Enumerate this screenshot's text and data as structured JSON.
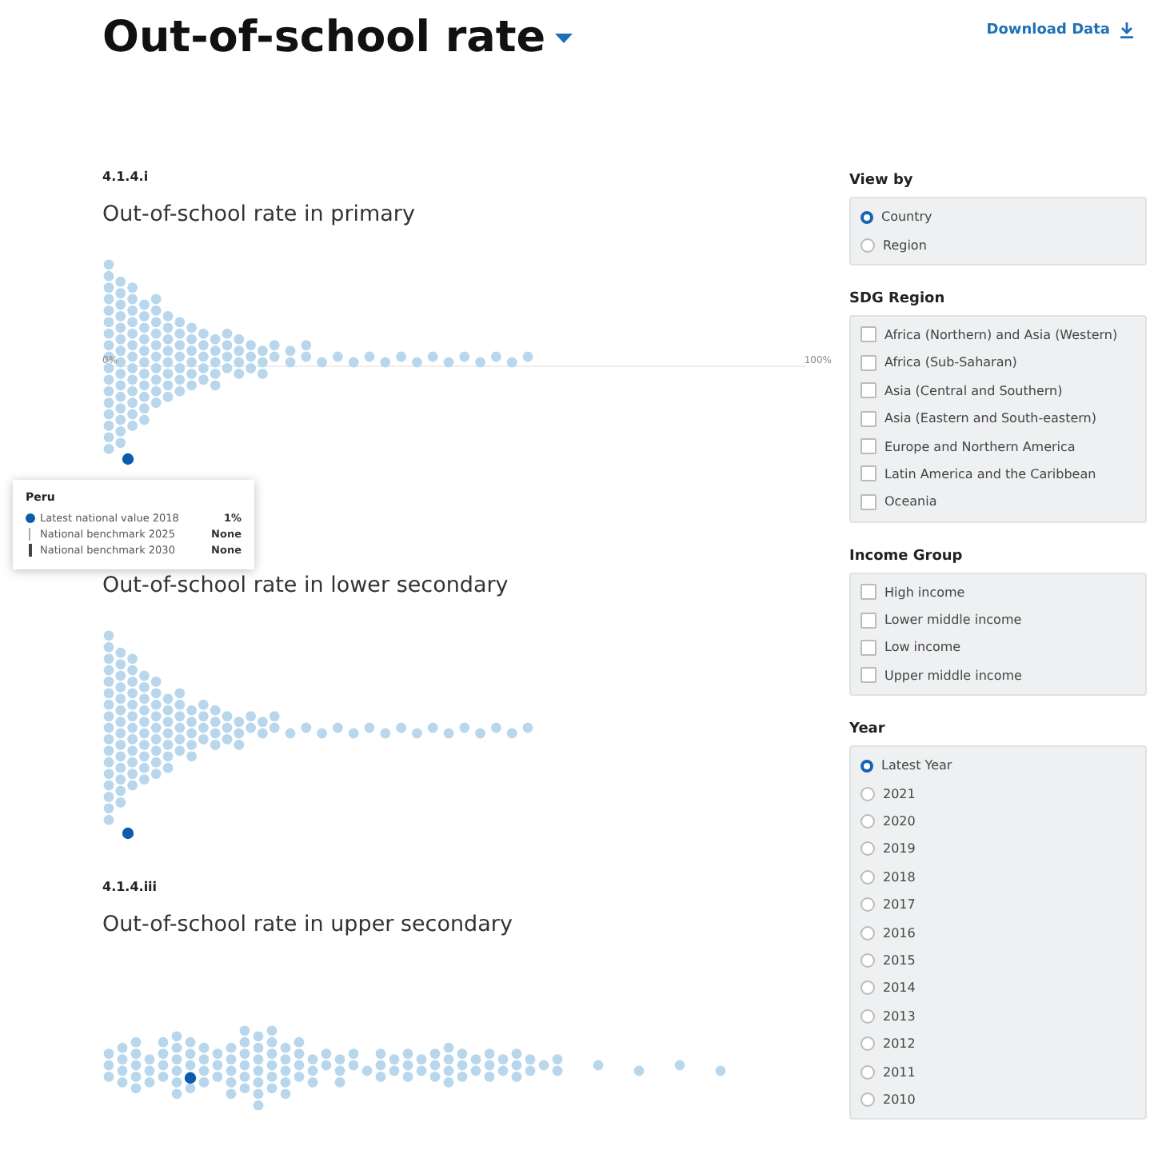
{
  "header": {
    "title": "Out-of-school rate",
    "download_link": "Download Data"
  },
  "charts": [
    {
      "code": "4.1.4.i",
      "title": "Out-of-school rate in primary",
      "kind": "fan",
      "axis_min_label": "0%",
      "axis_max_label": "100%"
    },
    {
      "title": "Out-of-school rate in lower secondary",
      "kind": "fan"
    },
    {
      "code": "4.1.4.iii",
      "title": "Out-of-school rate in upper secondary",
      "kind": "wide"
    }
  ],
  "tooltip": {
    "country": "Peru",
    "rows": [
      {
        "kind": "dot",
        "label": "Latest national value 2018",
        "value": "1%"
      },
      {
        "kind": "thin-line",
        "label": "National benchmark 2025",
        "value": "None"
      },
      {
        "kind": "thick-line",
        "label": "National benchmark 2030",
        "value": "None"
      }
    ]
  },
  "filters": [
    {
      "title": "View by",
      "kind": "radio",
      "options": [
        {
          "label": "Country",
          "selected": true
        },
        {
          "label": "Region",
          "selected": false
        }
      ]
    },
    {
      "title": "SDG Region",
      "kind": "checkbox",
      "options": [
        {
          "label": "Africa (Northern) and Asia (Western)",
          "checked": false
        },
        {
          "label": "Africa (Sub-Saharan)",
          "checked": false
        },
        {
          "label": "Asia (Central and Southern)",
          "checked": false
        },
        {
          "label": "Asia (Eastern and South-eastern)",
          "checked": false
        },
        {
          "label": "Europe and Northern America",
          "checked": false
        },
        {
          "label": "Latin America and the Caribbean",
          "checked": false
        },
        {
          "label": "Oceania",
          "checked": false
        }
      ]
    },
    {
      "title": "Income Group",
      "kind": "checkbox",
      "options": [
        {
          "label": "High income",
          "checked": false
        },
        {
          "label": "Lower middle income",
          "checked": false
        },
        {
          "label": "Low income",
          "checked": false
        },
        {
          "label": "Upper middle income",
          "checked": false
        }
      ]
    },
    {
      "title": "Year",
      "kind": "radio",
      "options": [
        {
          "label": "Latest Year",
          "selected": true
        },
        {
          "label": "2021",
          "selected": false
        },
        {
          "label": "2020",
          "selected": false
        },
        {
          "label": "2019",
          "selected": false
        },
        {
          "label": "2018",
          "selected": false
        },
        {
          "label": "2017",
          "selected": false
        },
        {
          "label": "2016",
          "selected": false
        },
        {
          "label": "2015",
          "selected": false
        },
        {
          "label": "2014",
          "selected": false
        },
        {
          "label": "2013",
          "selected": false
        },
        {
          "label": "2012",
          "selected": false
        },
        {
          "label": "2011",
          "selected": false
        },
        {
          "label": "2010",
          "selected": false
        }
      ]
    }
  ]
}
